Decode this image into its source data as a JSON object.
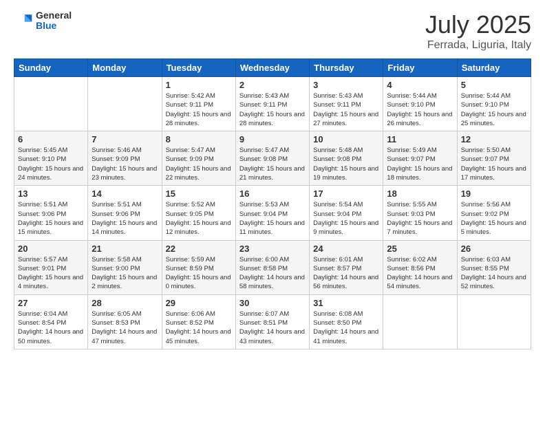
{
  "header": {
    "logo": {
      "general": "General",
      "blue": "Blue"
    },
    "title": "July 2025",
    "location": "Ferrada, Liguria, Italy"
  },
  "days_of_week": [
    "Sunday",
    "Monday",
    "Tuesday",
    "Wednesday",
    "Thursday",
    "Friday",
    "Saturday"
  ],
  "weeks": [
    [
      {
        "day": "",
        "sunrise": "",
        "sunset": "",
        "daylight": ""
      },
      {
        "day": "",
        "sunrise": "",
        "sunset": "",
        "daylight": ""
      },
      {
        "day": "1",
        "sunrise": "Sunrise: 5:42 AM",
        "sunset": "Sunset: 9:11 PM",
        "daylight": "Daylight: 15 hours and 28 minutes."
      },
      {
        "day": "2",
        "sunrise": "Sunrise: 5:43 AM",
        "sunset": "Sunset: 9:11 PM",
        "daylight": "Daylight: 15 hours and 28 minutes."
      },
      {
        "day": "3",
        "sunrise": "Sunrise: 5:43 AM",
        "sunset": "Sunset: 9:11 PM",
        "daylight": "Daylight: 15 hours and 27 minutes."
      },
      {
        "day": "4",
        "sunrise": "Sunrise: 5:44 AM",
        "sunset": "Sunset: 9:10 PM",
        "daylight": "Daylight: 15 hours and 26 minutes."
      },
      {
        "day": "5",
        "sunrise": "Sunrise: 5:44 AM",
        "sunset": "Sunset: 9:10 PM",
        "daylight": "Daylight: 15 hours and 25 minutes."
      }
    ],
    [
      {
        "day": "6",
        "sunrise": "Sunrise: 5:45 AM",
        "sunset": "Sunset: 9:10 PM",
        "daylight": "Daylight: 15 hours and 24 minutes."
      },
      {
        "day": "7",
        "sunrise": "Sunrise: 5:46 AM",
        "sunset": "Sunset: 9:09 PM",
        "daylight": "Daylight: 15 hours and 23 minutes."
      },
      {
        "day": "8",
        "sunrise": "Sunrise: 5:47 AM",
        "sunset": "Sunset: 9:09 PM",
        "daylight": "Daylight: 15 hours and 22 minutes."
      },
      {
        "day": "9",
        "sunrise": "Sunrise: 5:47 AM",
        "sunset": "Sunset: 9:08 PM",
        "daylight": "Daylight: 15 hours and 21 minutes."
      },
      {
        "day": "10",
        "sunrise": "Sunrise: 5:48 AM",
        "sunset": "Sunset: 9:08 PM",
        "daylight": "Daylight: 15 hours and 19 minutes."
      },
      {
        "day": "11",
        "sunrise": "Sunrise: 5:49 AM",
        "sunset": "Sunset: 9:07 PM",
        "daylight": "Daylight: 15 hours and 18 minutes."
      },
      {
        "day": "12",
        "sunrise": "Sunrise: 5:50 AM",
        "sunset": "Sunset: 9:07 PM",
        "daylight": "Daylight: 15 hours and 17 minutes."
      }
    ],
    [
      {
        "day": "13",
        "sunrise": "Sunrise: 5:51 AM",
        "sunset": "Sunset: 9:06 PM",
        "daylight": "Daylight: 15 hours and 15 minutes."
      },
      {
        "day": "14",
        "sunrise": "Sunrise: 5:51 AM",
        "sunset": "Sunset: 9:06 PM",
        "daylight": "Daylight: 15 hours and 14 minutes."
      },
      {
        "day": "15",
        "sunrise": "Sunrise: 5:52 AM",
        "sunset": "Sunset: 9:05 PM",
        "daylight": "Daylight: 15 hours and 12 minutes."
      },
      {
        "day": "16",
        "sunrise": "Sunrise: 5:53 AM",
        "sunset": "Sunset: 9:04 PM",
        "daylight": "Daylight: 15 hours and 11 minutes."
      },
      {
        "day": "17",
        "sunrise": "Sunrise: 5:54 AM",
        "sunset": "Sunset: 9:04 PM",
        "daylight": "Daylight: 15 hours and 9 minutes."
      },
      {
        "day": "18",
        "sunrise": "Sunrise: 5:55 AM",
        "sunset": "Sunset: 9:03 PM",
        "daylight": "Daylight: 15 hours and 7 minutes."
      },
      {
        "day": "19",
        "sunrise": "Sunrise: 5:56 AM",
        "sunset": "Sunset: 9:02 PM",
        "daylight": "Daylight: 15 hours and 5 minutes."
      }
    ],
    [
      {
        "day": "20",
        "sunrise": "Sunrise: 5:57 AM",
        "sunset": "Sunset: 9:01 PM",
        "daylight": "Daylight: 15 hours and 4 minutes."
      },
      {
        "day": "21",
        "sunrise": "Sunrise: 5:58 AM",
        "sunset": "Sunset: 9:00 PM",
        "daylight": "Daylight: 15 hours and 2 minutes."
      },
      {
        "day": "22",
        "sunrise": "Sunrise: 5:59 AM",
        "sunset": "Sunset: 8:59 PM",
        "daylight": "Daylight: 15 hours and 0 minutes."
      },
      {
        "day": "23",
        "sunrise": "Sunrise: 6:00 AM",
        "sunset": "Sunset: 8:58 PM",
        "daylight": "Daylight: 14 hours and 58 minutes."
      },
      {
        "day": "24",
        "sunrise": "Sunrise: 6:01 AM",
        "sunset": "Sunset: 8:57 PM",
        "daylight": "Daylight: 14 hours and 56 minutes."
      },
      {
        "day": "25",
        "sunrise": "Sunrise: 6:02 AM",
        "sunset": "Sunset: 8:56 PM",
        "daylight": "Daylight: 14 hours and 54 minutes."
      },
      {
        "day": "26",
        "sunrise": "Sunrise: 6:03 AM",
        "sunset": "Sunset: 8:55 PM",
        "daylight": "Daylight: 14 hours and 52 minutes."
      }
    ],
    [
      {
        "day": "27",
        "sunrise": "Sunrise: 6:04 AM",
        "sunset": "Sunset: 8:54 PM",
        "daylight": "Daylight: 14 hours and 50 minutes."
      },
      {
        "day": "28",
        "sunrise": "Sunrise: 6:05 AM",
        "sunset": "Sunset: 8:53 PM",
        "daylight": "Daylight: 14 hours and 47 minutes."
      },
      {
        "day": "29",
        "sunrise": "Sunrise: 6:06 AM",
        "sunset": "Sunset: 8:52 PM",
        "daylight": "Daylight: 14 hours and 45 minutes."
      },
      {
        "day": "30",
        "sunrise": "Sunrise: 6:07 AM",
        "sunset": "Sunset: 8:51 PM",
        "daylight": "Daylight: 14 hours and 43 minutes."
      },
      {
        "day": "31",
        "sunrise": "Sunrise: 6:08 AM",
        "sunset": "Sunset: 8:50 PM",
        "daylight": "Daylight: 14 hours and 41 minutes."
      },
      {
        "day": "",
        "sunrise": "",
        "sunset": "",
        "daylight": ""
      },
      {
        "day": "",
        "sunrise": "",
        "sunset": "",
        "daylight": ""
      }
    ]
  ]
}
